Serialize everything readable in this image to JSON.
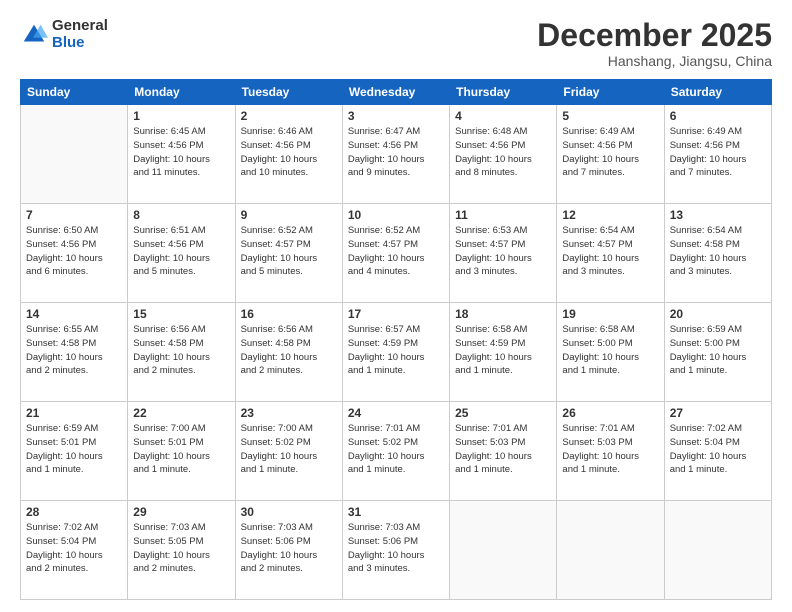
{
  "logo": {
    "general": "General",
    "blue": "Blue"
  },
  "title": {
    "month": "December 2025",
    "location": "Hanshang, Jiangsu, China"
  },
  "days_of_week": [
    "Sunday",
    "Monday",
    "Tuesday",
    "Wednesday",
    "Thursday",
    "Friday",
    "Saturday"
  ],
  "weeks": [
    [
      {
        "day": "",
        "info": ""
      },
      {
        "day": "1",
        "info": "Sunrise: 6:45 AM\nSunset: 4:56 PM\nDaylight: 10 hours\nand 11 minutes."
      },
      {
        "day": "2",
        "info": "Sunrise: 6:46 AM\nSunset: 4:56 PM\nDaylight: 10 hours\nand 10 minutes."
      },
      {
        "day": "3",
        "info": "Sunrise: 6:47 AM\nSunset: 4:56 PM\nDaylight: 10 hours\nand 9 minutes."
      },
      {
        "day": "4",
        "info": "Sunrise: 6:48 AM\nSunset: 4:56 PM\nDaylight: 10 hours\nand 8 minutes."
      },
      {
        "day": "5",
        "info": "Sunrise: 6:49 AM\nSunset: 4:56 PM\nDaylight: 10 hours\nand 7 minutes."
      },
      {
        "day": "6",
        "info": "Sunrise: 6:49 AM\nSunset: 4:56 PM\nDaylight: 10 hours\nand 7 minutes."
      }
    ],
    [
      {
        "day": "7",
        "info": "Sunrise: 6:50 AM\nSunset: 4:56 PM\nDaylight: 10 hours\nand 6 minutes."
      },
      {
        "day": "8",
        "info": "Sunrise: 6:51 AM\nSunset: 4:56 PM\nDaylight: 10 hours\nand 5 minutes."
      },
      {
        "day": "9",
        "info": "Sunrise: 6:52 AM\nSunset: 4:57 PM\nDaylight: 10 hours\nand 5 minutes."
      },
      {
        "day": "10",
        "info": "Sunrise: 6:52 AM\nSunset: 4:57 PM\nDaylight: 10 hours\nand 4 minutes."
      },
      {
        "day": "11",
        "info": "Sunrise: 6:53 AM\nSunset: 4:57 PM\nDaylight: 10 hours\nand 3 minutes."
      },
      {
        "day": "12",
        "info": "Sunrise: 6:54 AM\nSunset: 4:57 PM\nDaylight: 10 hours\nand 3 minutes."
      },
      {
        "day": "13",
        "info": "Sunrise: 6:54 AM\nSunset: 4:58 PM\nDaylight: 10 hours\nand 3 minutes."
      }
    ],
    [
      {
        "day": "14",
        "info": "Sunrise: 6:55 AM\nSunset: 4:58 PM\nDaylight: 10 hours\nand 2 minutes."
      },
      {
        "day": "15",
        "info": "Sunrise: 6:56 AM\nSunset: 4:58 PM\nDaylight: 10 hours\nand 2 minutes."
      },
      {
        "day": "16",
        "info": "Sunrise: 6:56 AM\nSunset: 4:58 PM\nDaylight: 10 hours\nand 2 minutes."
      },
      {
        "day": "17",
        "info": "Sunrise: 6:57 AM\nSunset: 4:59 PM\nDaylight: 10 hours\nand 1 minute."
      },
      {
        "day": "18",
        "info": "Sunrise: 6:58 AM\nSunset: 4:59 PM\nDaylight: 10 hours\nand 1 minute."
      },
      {
        "day": "19",
        "info": "Sunrise: 6:58 AM\nSunset: 5:00 PM\nDaylight: 10 hours\nand 1 minute."
      },
      {
        "day": "20",
        "info": "Sunrise: 6:59 AM\nSunset: 5:00 PM\nDaylight: 10 hours\nand 1 minute."
      }
    ],
    [
      {
        "day": "21",
        "info": "Sunrise: 6:59 AM\nSunset: 5:01 PM\nDaylight: 10 hours\nand 1 minute."
      },
      {
        "day": "22",
        "info": "Sunrise: 7:00 AM\nSunset: 5:01 PM\nDaylight: 10 hours\nand 1 minute."
      },
      {
        "day": "23",
        "info": "Sunrise: 7:00 AM\nSunset: 5:02 PM\nDaylight: 10 hours\nand 1 minute."
      },
      {
        "day": "24",
        "info": "Sunrise: 7:01 AM\nSunset: 5:02 PM\nDaylight: 10 hours\nand 1 minute."
      },
      {
        "day": "25",
        "info": "Sunrise: 7:01 AM\nSunset: 5:03 PM\nDaylight: 10 hours\nand 1 minute."
      },
      {
        "day": "26",
        "info": "Sunrise: 7:01 AM\nSunset: 5:03 PM\nDaylight: 10 hours\nand 1 minute."
      },
      {
        "day": "27",
        "info": "Sunrise: 7:02 AM\nSunset: 5:04 PM\nDaylight: 10 hours\nand 1 minute."
      }
    ],
    [
      {
        "day": "28",
        "info": "Sunrise: 7:02 AM\nSunset: 5:04 PM\nDaylight: 10 hours\nand 2 minutes."
      },
      {
        "day": "29",
        "info": "Sunrise: 7:03 AM\nSunset: 5:05 PM\nDaylight: 10 hours\nand 2 minutes."
      },
      {
        "day": "30",
        "info": "Sunrise: 7:03 AM\nSunset: 5:06 PM\nDaylight: 10 hours\nand 2 minutes."
      },
      {
        "day": "31",
        "info": "Sunrise: 7:03 AM\nSunset: 5:06 PM\nDaylight: 10 hours\nand 3 minutes."
      },
      {
        "day": "",
        "info": ""
      },
      {
        "day": "",
        "info": ""
      },
      {
        "day": "",
        "info": ""
      }
    ]
  ]
}
